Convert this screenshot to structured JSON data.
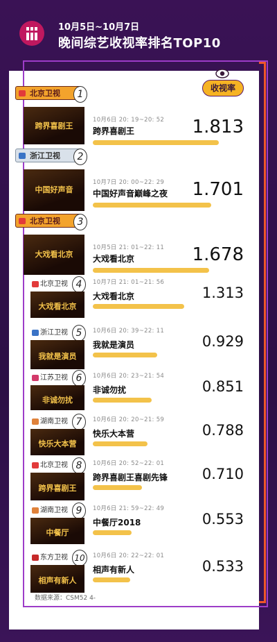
{
  "header": {
    "date_range": "10月5日~10月7日",
    "title": "晚间综艺收视率排名TOP10",
    "legend": "收视率"
  },
  "chart_data": {
    "type": "bar",
    "title": "晚间综艺收视率排名TOP10",
    "subtitle": "10月5日~10月7日",
    "value_label": "收视率",
    "categories": [
      "跨界喜剧王",
      "中国好声音巅峰之夜",
      "大戏看北京",
      "大戏看北京",
      "我就是演员",
      "非诚勿扰",
      "快乐大本营",
      "跨界喜剧王喜剧先锋",
      "中餐厅2018",
      "相声有新人"
    ],
    "values": [
      1.813,
      1.701,
      1.678,
      1.313,
      0.929,
      0.851,
      0.788,
      0.71,
      0.553,
      0.533
    ],
    "value_labels": [
      "1.813",
      "1.701",
      "1.678",
      "1.313",
      "0.929",
      "0.851",
      "0.788",
      "0.710",
      "0.553",
      "0.533"
    ],
    "ranks": [
      "1",
      "2",
      "3",
      "4",
      "5",
      "6",
      "7",
      "8",
      "9",
      "10"
    ],
    "channels": [
      "北京卫视",
      "浙江卫视",
      "北京卫视",
      "北京卫视",
      "浙江卫视",
      "江苏卫视",
      "湖南卫视",
      "北京卫视",
      "湖南卫视",
      "东方卫视"
    ],
    "times": [
      "10月6日 20: 19~20: 52",
      "10月7日 20: 00~22: 29",
      "10月5日 21: 01~22: 11",
      "10月7日 21: 01~21: 56",
      "10月6日 20: 39~22: 11",
      "10月6日 20: 23~21: 54",
      "10月6日 20: 20~21: 59",
      "10月6日 20: 52~22: 01",
      "10月6日 21: 59~22: 49",
      "10月6日 20: 22~22: 01"
    ],
    "thumbnail_text": [
      "跨界喜剧王",
      "中国好声音",
      "大戏看北京",
      "大戏看北京",
      "我就是演员",
      "非诚勿扰",
      "快乐大本营",
      "跨界喜剧王",
      "中餐厅",
      "相声有新人"
    ]
  },
  "colors": {
    "background": "#2c0f45",
    "bar": "#f3c24a",
    "tag_top": "#f3a32c",
    "frame": "#9d3cc8",
    "accent": "#f0572a"
  },
  "footer": {
    "source": "数据来源：CSM52 4-"
  }
}
